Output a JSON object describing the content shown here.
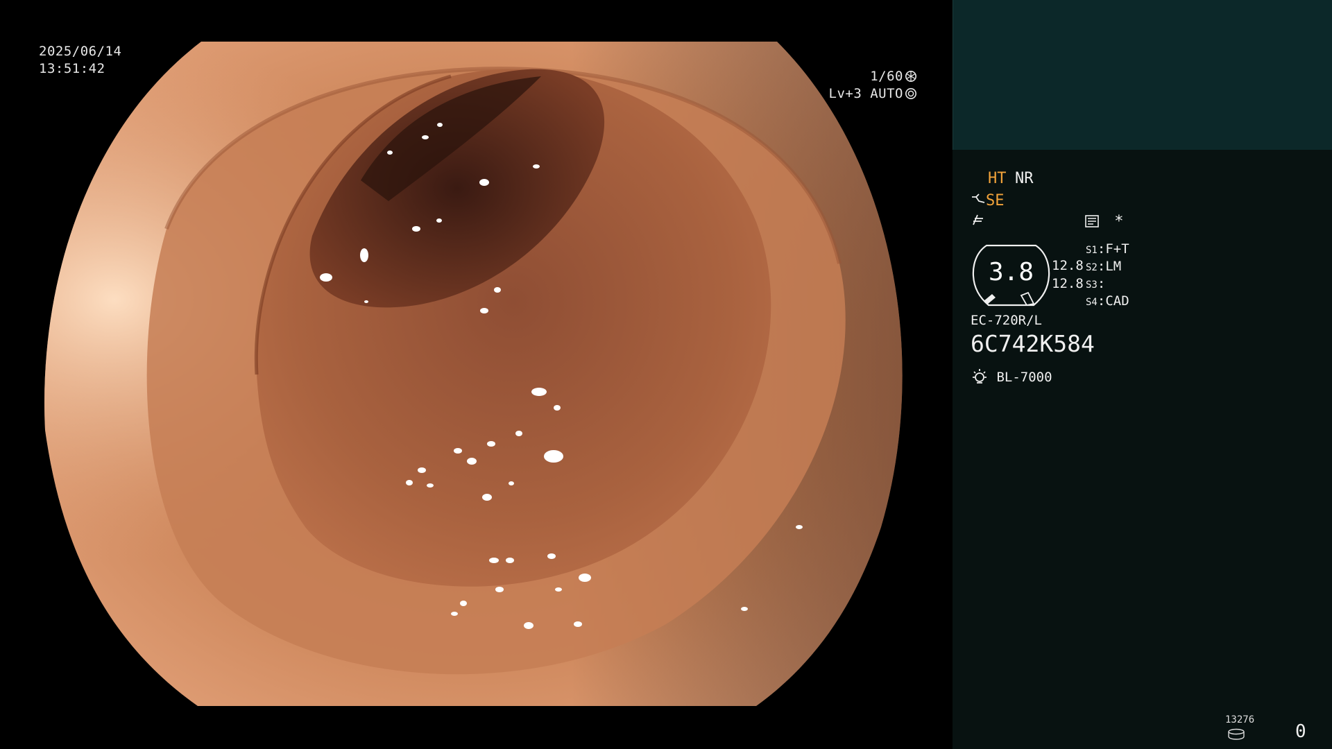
{
  "osd": {
    "date": "2025/06/14",
    "time": "13:51:42",
    "shutter": "1/60",
    "brightness_mode": "Lv+3 AUTO",
    "shutter_icon": "aperture-icon",
    "auto_icon": "iris-icon"
  },
  "panel": {
    "mode_ht": "HT",
    "mode_nr": "NR",
    "se_icon": "scope-tip-icon",
    "se_label": "SE",
    "enhance_icon": "enhancement-icon",
    "memo_icon": "memo-icon",
    "star_label": "*",
    "gauge_value": "3.8",
    "gauge_read_1": "12.8",
    "gauge_read_2": "12.8",
    "switches": [
      {
        "key": "S1",
        "value": "F+T"
      },
      {
        "key": "S2",
        "value": "LM"
      },
      {
        "key": "S3",
        "value": ""
      },
      {
        "key": "S4",
        "value": "CAD"
      }
    ],
    "scope_model": "EC-720R/L",
    "scope_serial": "6C742K584",
    "light_icon": "light-source-icon",
    "light_source": "BL-7000",
    "storage_icon": "storage-icon",
    "image_count": "13276",
    "counter": "0"
  },
  "colors": {
    "panel_bg": "#081211",
    "preview_bg": "#0c2829",
    "accent_orange": "#f2a33a"
  }
}
